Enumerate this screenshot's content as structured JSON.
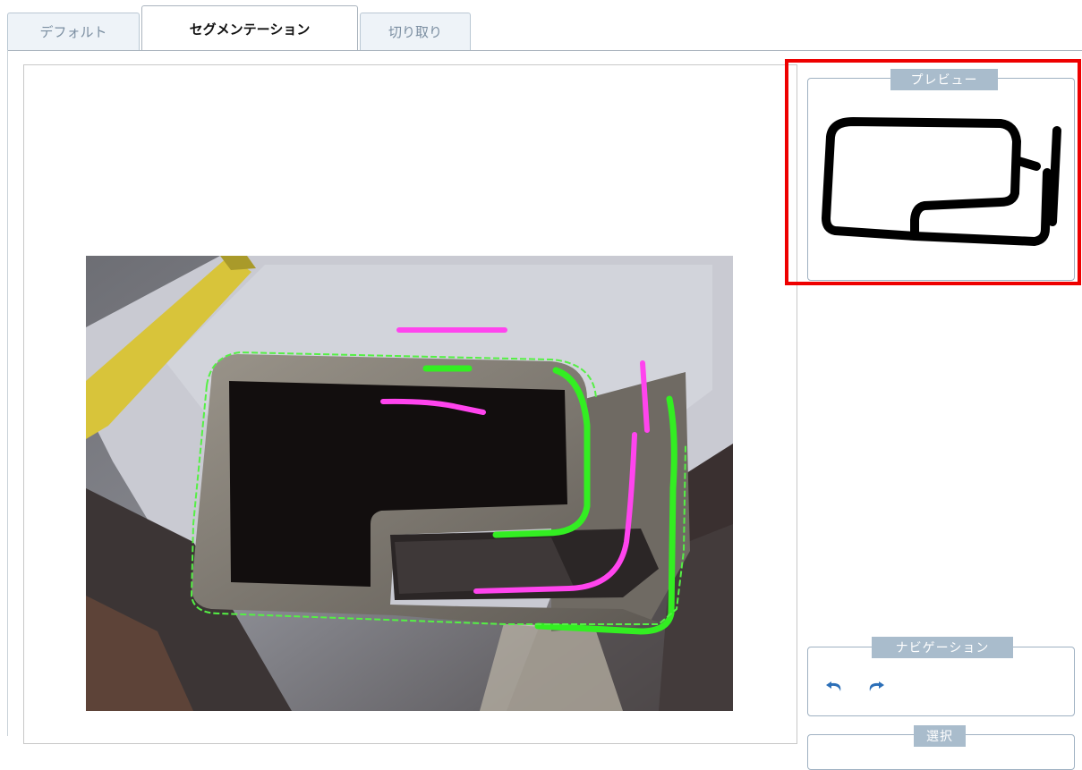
{
  "tabs": [
    {
      "label": "デフォルト",
      "active": false
    },
    {
      "label": "セグメンテーション",
      "active": true
    },
    {
      "label": "切り取り",
      "active": false
    }
  ],
  "preview": {
    "legend": "プレビュー"
  },
  "navigation": {
    "legend": "ナビゲーション",
    "buttons": [
      {
        "icon": "undo-icon"
      },
      {
        "icon": "redo-icon"
      }
    ]
  },
  "selection": {
    "legend": "選択"
  },
  "colors": {
    "highlight": "#ee0000",
    "foreground_stroke": "#33ee22",
    "background_stroke": "#ff44ee",
    "legend_bg": "#a9bccc"
  }
}
